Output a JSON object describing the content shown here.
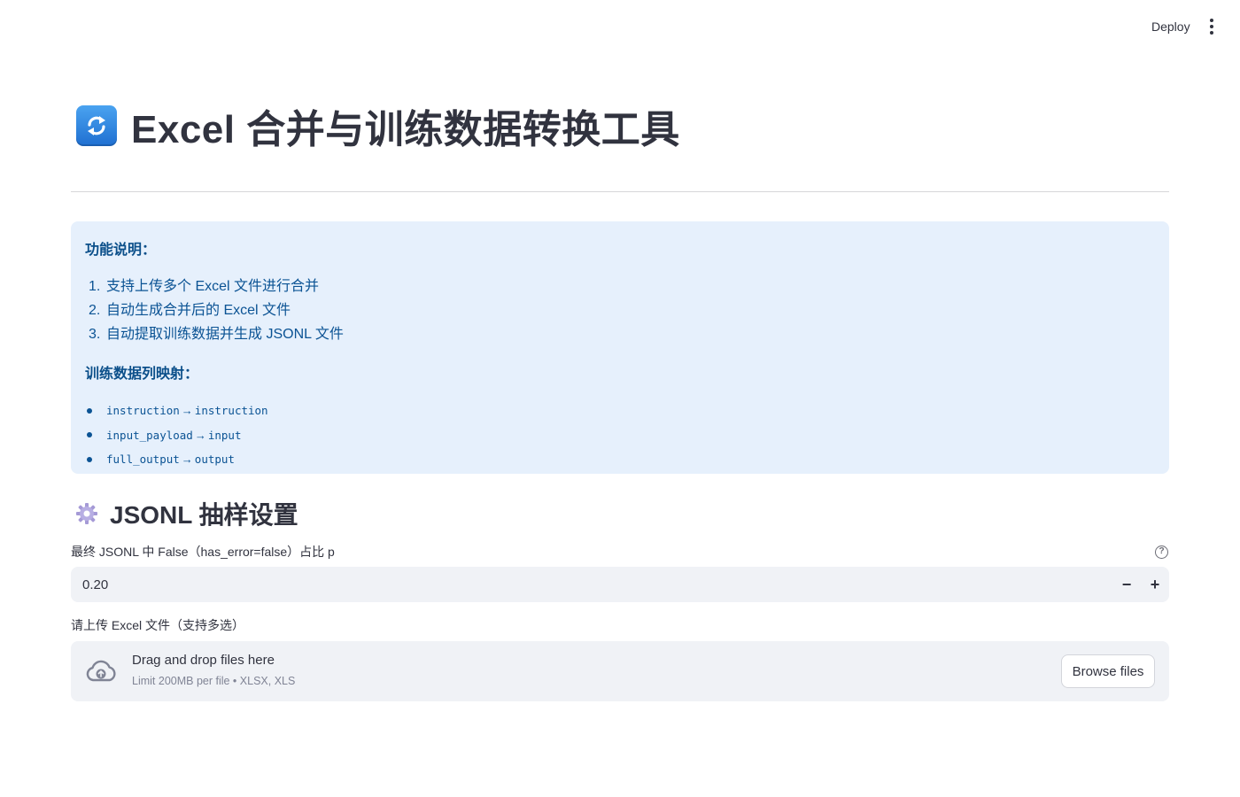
{
  "header": {
    "deploy_label": "Deploy",
    "menu_icon": "vertical-dots-icon"
  },
  "page": {
    "title_icon": "arrows-counterclockwise-icon",
    "title": "Excel 合并与训练数据转换工具"
  },
  "info": {
    "heading": "功能说明：",
    "steps": [
      {
        "num": "1.",
        "text": "支持上传多个 Excel 文件进行合并"
      },
      {
        "num": "2.",
        "text": "自动生成合并后的 Excel 文件"
      },
      {
        "num": "3.",
        "text": "自动提取训练数据并生成 JSONL 文件"
      }
    ],
    "mapping_heading": "训练数据列映射：",
    "mappings": [
      {
        "from": "instruction",
        "arrow": "→",
        "to": "instruction"
      },
      {
        "from": "input_payload",
        "arrow": "→",
        "to": "input"
      },
      {
        "from": "full_output",
        "arrow": "→",
        "to": "output"
      }
    ]
  },
  "sampling": {
    "section_icon": "gear-icon",
    "section_title": "JSONL 抽样设置",
    "ratio_label": "最终 JSONL 中 False（has_error=false）占比 p",
    "ratio_value": "0.20",
    "help_icon": "question-circle-icon",
    "minus_label": "−",
    "plus_label": "+"
  },
  "upload": {
    "label": "请上传 Excel 文件（支持多选）",
    "drop_text": "Drag and drop files here",
    "limit_text": "Limit 200MB per file • XLSX, XLS",
    "browse_label": "Browse files",
    "icon": "cloud-upload-icon"
  },
  "colors": {
    "info_bg": "#e6f0fc",
    "info_text": "#0b5394",
    "input_bg": "#f0f2f6",
    "text": "#31333f"
  }
}
